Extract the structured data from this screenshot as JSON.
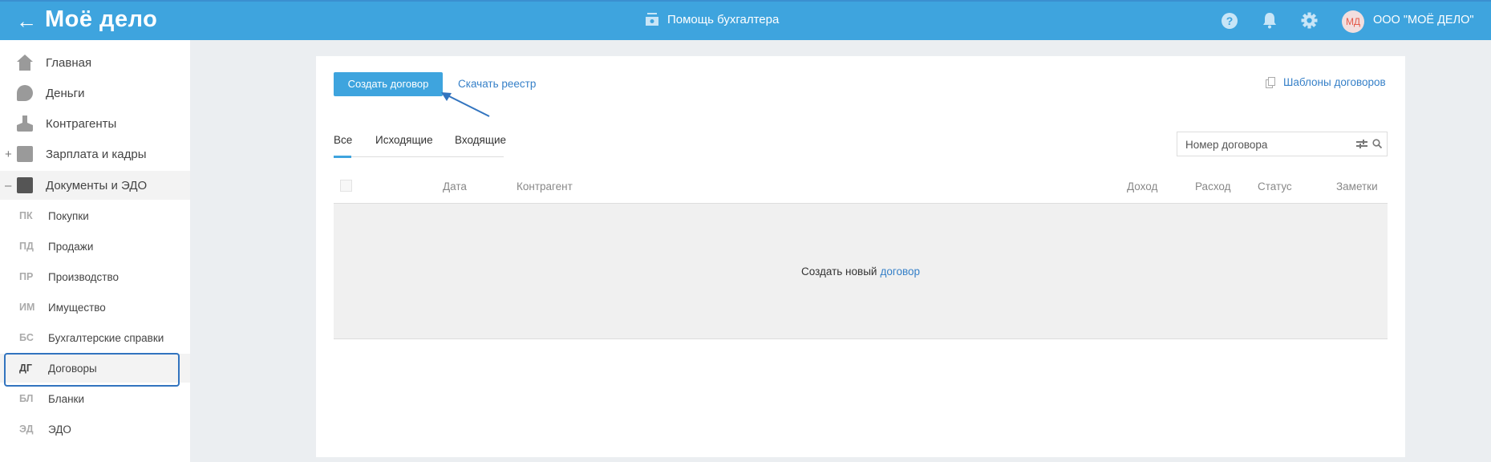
{
  "header": {
    "back_icon": "arrow-left-icon",
    "logo": "Моё дело",
    "help_label": "Помощь бухгалтера",
    "avatar_initials": "МД",
    "org_name": "ООО \"МОЁ ДЕЛО\"",
    "colors": {
      "brand": "#3ea4de"
    }
  },
  "sidebar": {
    "items": [
      {
        "label": "Главная",
        "icon": "home-icon"
      },
      {
        "label": "Деньги",
        "icon": "money-icon"
      },
      {
        "label": "Контрагенты",
        "icon": "person-icon"
      },
      {
        "label": "Зарплата и кадры",
        "icon": "wallet-icon",
        "toggle": "+"
      },
      {
        "label": "Документы и ЭДО",
        "icon": "folder-icon",
        "toggle": "–"
      }
    ],
    "sub_items": [
      {
        "abbr": "ПК",
        "label": "Покупки"
      },
      {
        "abbr": "ПД",
        "label": "Продажи"
      },
      {
        "abbr": "ПР",
        "label": "Производство"
      },
      {
        "abbr": "ИМ",
        "label": "Имущество"
      },
      {
        "abbr": "БС",
        "label": "Бухгалтерские справки"
      },
      {
        "abbr": "ДГ",
        "label": "Договоры"
      },
      {
        "abbr": "БЛ",
        "label": "Бланки"
      },
      {
        "abbr": "ЭД",
        "label": "ЭДО"
      }
    ]
  },
  "main": {
    "create_button": "Создать договор",
    "download_link": "Скачать реестр",
    "templates_link": "Шаблоны договоров",
    "tabs": [
      "Все",
      "Исходящие",
      "Входящие"
    ],
    "search_placeholder": "Номер договора",
    "columns": [
      "Дата",
      "Контрагент",
      "Доход",
      "Расход",
      "Статус",
      "Заметки"
    ],
    "empty_text": "Создать новый",
    "empty_link": "договор"
  }
}
